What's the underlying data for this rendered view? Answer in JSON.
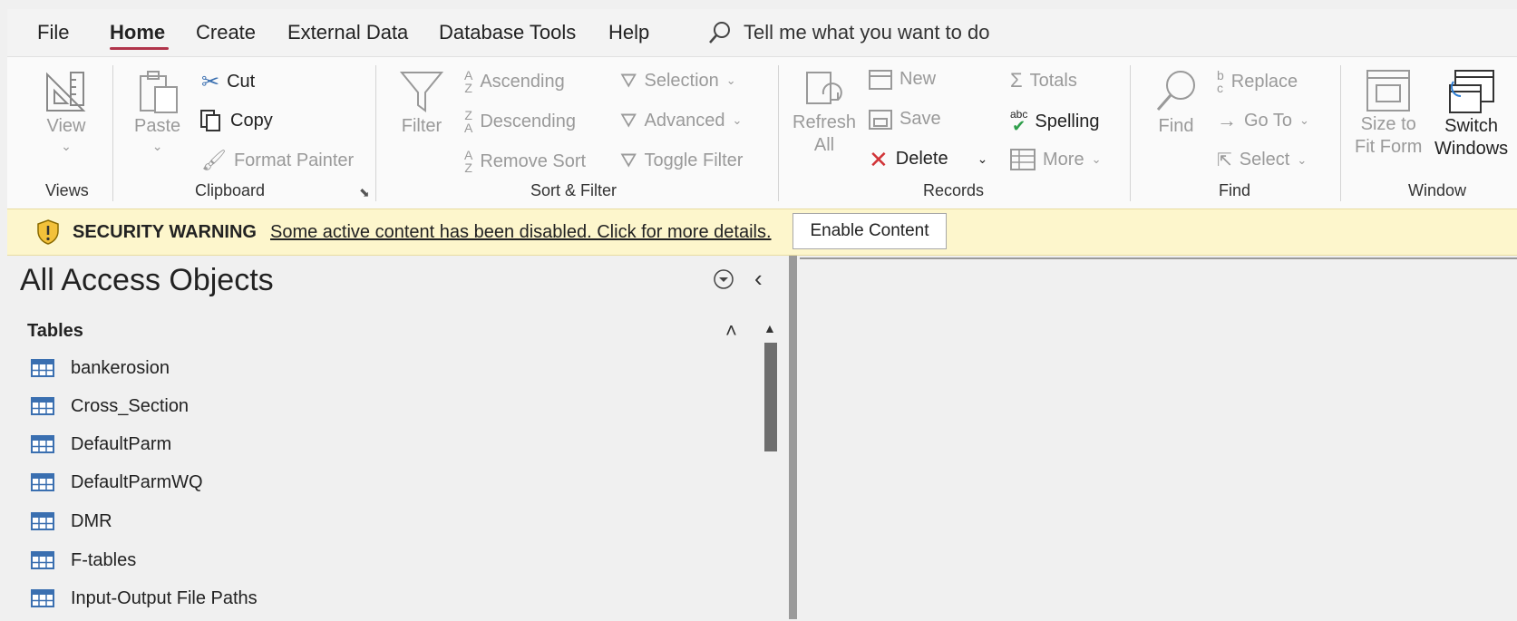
{
  "menu": {
    "items": [
      "File",
      "Home",
      "Create",
      "External Data",
      "Database Tools",
      "Help"
    ],
    "active": "Home",
    "tell_me": "Tell me what you want to do"
  },
  "ribbon": {
    "views": {
      "view_label": "View",
      "group": "Views"
    },
    "clipboard": {
      "paste": "Paste",
      "cut": "Cut",
      "copy": "Copy",
      "format_painter": "Format Painter",
      "group": "Clipboard"
    },
    "sort_filter": {
      "filter": "Filter",
      "ascending": "Ascending",
      "descending": "Descending",
      "remove_sort": "Remove Sort",
      "selection": "Selection",
      "advanced": "Advanced",
      "toggle_filter": "Toggle Filter",
      "group": "Sort & Filter"
    },
    "records": {
      "refresh_line1": "Refresh",
      "refresh_line2": "All",
      "new": "New",
      "save": "Save",
      "delete": "Delete",
      "totals": "Totals",
      "spelling": "Spelling",
      "more": "More",
      "group": "Records"
    },
    "find": {
      "find": "Find",
      "replace": "Replace",
      "go_to": "Go To",
      "select": "Select",
      "group": "Find"
    },
    "window": {
      "size_line1": "Size to",
      "size_line2": "Fit Form",
      "switch_line1": "Switch",
      "switch_line2": "Windows",
      "group": "Window"
    }
  },
  "security": {
    "title": "SECURITY WARNING",
    "message": "Some active content has been disabled. Click for more details.",
    "button": "Enable Content"
  },
  "nav": {
    "title": "All Access Objects",
    "section": "Tables",
    "tables": [
      "bankerosion",
      "Cross_Section",
      "DefaultParm",
      "DefaultParmWQ",
      "DMR",
      "F-tables",
      "Input-Output File Paths"
    ]
  },
  "colors": {
    "accent": "#b0344a",
    "warning_bg": "#fdf6cc",
    "delete_x": "#d13438",
    "spelling_check": "#2e9e4a"
  }
}
